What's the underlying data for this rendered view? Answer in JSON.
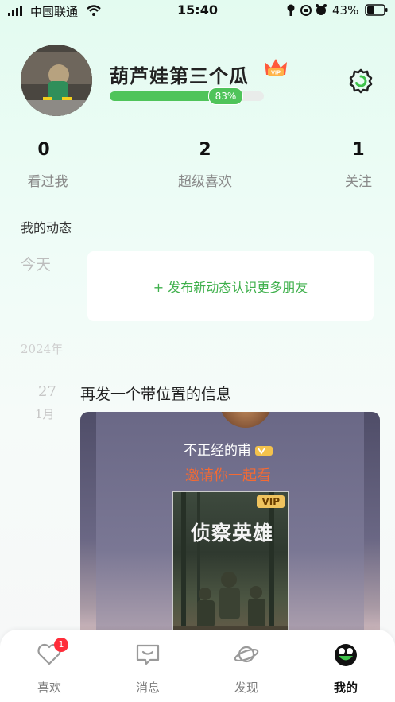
{
  "status_bar": {
    "carrier": "中国联通",
    "time": "15:40",
    "battery": "43%"
  },
  "profile": {
    "username": "葫芦娃第三个瓜",
    "vip_badge": "VIP",
    "profile_completion": "83%",
    "profile_completion_value": 0.83
  },
  "stats": [
    {
      "value": "0",
      "label": "看过我"
    },
    {
      "value": "2",
      "label": "超级喜欢"
    },
    {
      "value": "1",
      "label": "关注"
    }
  ],
  "feed": {
    "section_title": "我的动态",
    "today_label": "今天",
    "new_post_prompt": "+ 发布新动态认识更多朋友",
    "year_label": "2024年",
    "entries": [
      {
        "day": "27",
        "month": "1月",
        "text": "再发一个带位置的信息",
        "share": {
          "name": "不正经的甫",
          "invite": "邀请你一起看",
          "poster_title": "侦察英雄",
          "poster_badge": "VIP"
        }
      }
    ]
  },
  "tabbar": [
    {
      "label": "喜欢",
      "icon": "heart-icon",
      "badge": "1"
    },
    {
      "label": "消息",
      "icon": "message-icon"
    },
    {
      "label": "发现",
      "icon": "planet-icon"
    },
    {
      "label": "我的",
      "icon": "frog-face-icon",
      "active": true
    }
  ],
  "colors": {
    "accent": "#4fc45a",
    "badge": "#ff2d3a",
    "invite": "#f46a33"
  }
}
